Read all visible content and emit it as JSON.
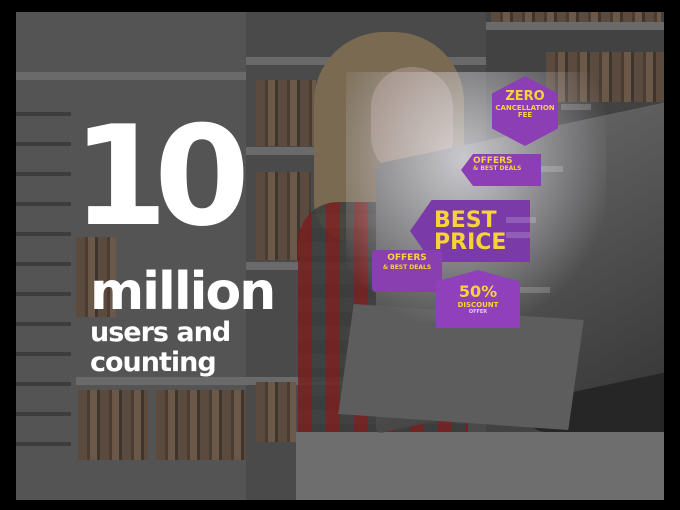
{
  "headline": {
    "number": "10",
    "unit": "million",
    "line1": "users and",
    "line2": "counting"
  },
  "promo_tags": {
    "zero_fee": {
      "title": "ZERO",
      "sub": "CANCELLATION FEE"
    },
    "offers_top": {
      "title": "OFFERS",
      "sub": "& BEST DEALS"
    },
    "best_price": {
      "title": "BEST PRICE"
    },
    "offers_left": {
      "title": "OFFERS",
      "sub": "& BEST DEALS"
    },
    "discount": {
      "title": "50%",
      "sub": "DISCOUNT",
      "sub2": "OFFER"
    }
  },
  "colors": {
    "headline": "#ffffff",
    "tag_background": "#8c3fb4",
    "tag_text": "#f7d23a",
    "frame_border": "#000000"
  }
}
